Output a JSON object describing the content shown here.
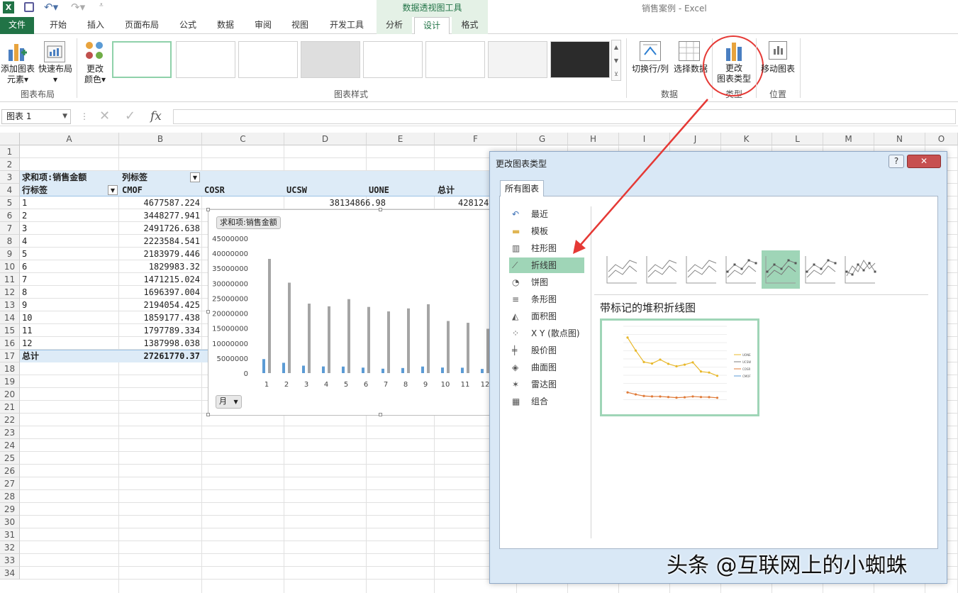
{
  "window": {
    "title": "销售案例 - Excel",
    "context_tab_group": "数据透视图工具"
  },
  "ribbon_tabs": [
    "文件",
    "开始",
    "插入",
    "页面布局",
    "公式",
    "数据",
    "审阅",
    "视图",
    "开发工具",
    "分析",
    "设计",
    "格式"
  ],
  "ribbon": {
    "add_element": [
      "添加图表",
      "元素"
    ],
    "quick_layout": "快速布局",
    "change_color": [
      "更改",
      "颜色"
    ],
    "switch_rowcol": "切换行/列",
    "select_data": "选择数据",
    "change_type": [
      "更改",
      "图表类型"
    ],
    "move_chart": "移动图表",
    "groups": {
      "layout": "图表布局",
      "styles": "图表样式",
      "data": "数据",
      "type": "类型",
      "location": "位置"
    }
  },
  "formula_bar": {
    "name_box": "图表 1",
    "fx": "fx",
    "value": ""
  },
  "columns": [
    "A",
    "B",
    "C",
    "D",
    "E",
    "F",
    "G",
    "H",
    "I",
    "J",
    "K",
    "L",
    "M",
    "N",
    "O"
  ],
  "rows": [
    "1",
    "2",
    "3",
    "4",
    "5",
    "6",
    "7",
    "8",
    "9",
    "10",
    "11",
    "12",
    "13",
    "14",
    "15",
    "16",
    "17",
    "18",
    "19",
    "20",
    "21",
    "22",
    "23",
    "24",
    "25",
    "26",
    "27",
    "28",
    "29",
    "30",
    "31",
    "32",
    "33",
    "34"
  ],
  "pivot": {
    "values_label": "求和项:销售金额",
    "col_labels": "列标签",
    "row_labels": "行标签",
    "col_headers": [
      "CMOF",
      "COSR",
      "UCSW",
      "UONE",
      "总计"
    ],
    "row_values": [
      "1",
      "2",
      "3",
      "4",
      "5",
      "6",
      "7",
      "8",
      "9",
      "10",
      "11",
      "12"
    ],
    "col_b": [
      "4677587.224",
      "3448277.941",
      "2491726.638",
      "2223584.541",
      "2183979.446",
      "1829983.32",
      "1471215.024",
      "1696397.004",
      "2194054.425",
      "1859177.438",
      "1797789.334",
      "1387998.038"
    ],
    "d5": "38134866.98",
    "f5_partial": "428124",
    "total_label": "总计",
    "total_b": "27261770.37"
  },
  "chart_data": {
    "type": "bar",
    "title": "",
    "series_button": "求和项:销售金额",
    "field_button": "月",
    "categories": [
      "1",
      "2",
      "3",
      "4",
      "5",
      "6",
      "7",
      "8",
      "9",
      "10",
      "11",
      "12"
    ],
    "yticks": [
      "0",
      "5000000",
      "10000000",
      "15000000",
      "20000000",
      "25000000",
      "30000000",
      "35000000",
      "40000000",
      "45000000"
    ],
    "ylim": [
      0,
      45000000
    ],
    "series": [
      {
        "color": "#5b9bd5",
        "values": [
          4677587,
          3448278,
          2491727,
          2223585,
          2183979,
          1829983,
          1471215,
          1696397,
          2194054,
          1859177,
          1797789,
          1387998
        ]
      },
      {
        "color": "#a5a5a5",
        "values": [
          38134867,
          30200000,
          23200000,
          22300000,
          24700000,
          22100000,
          20600000,
          21600000,
          23000000,
          17400000,
          16800000,
          14800000
        ]
      }
    ]
  },
  "dialog": {
    "title": "更改图表类型",
    "help": "?",
    "close": "✕",
    "tab": "所有图表",
    "chart_types": [
      {
        "label": "最近",
        "icon": "recent-icon"
      },
      {
        "label": "模板",
        "icon": "folder-icon"
      },
      {
        "label": "柱形图",
        "icon": "column-chart-icon"
      },
      {
        "label": "折线图",
        "icon": "line-chart-icon"
      },
      {
        "label": "饼图",
        "icon": "pie-chart-icon"
      },
      {
        "label": "条形图",
        "icon": "bar-chart-icon"
      },
      {
        "label": "面积图",
        "icon": "area-chart-icon"
      },
      {
        "label": "X Y (散点图)",
        "icon": "scatter-chart-icon"
      },
      {
        "label": "股价图",
        "icon": "stock-chart-icon"
      },
      {
        "label": "曲面图",
        "icon": "surface-chart-icon"
      },
      {
        "label": "雷达图",
        "icon": "radar-chart-icon"
      },
      {
        "label": "组合",
        "icon": "combo-chart-icon"
      }
    ],
    "selected_index": 3,
    "subtype_selected": 4,
    "subtype_title": "带标记的堆积折线图",
    "preview_legend": [
      "UONE",
      "UCSW",
      "COSR",
      "CMOF"
    ]
  },
  "watermark": "头条 @互联网上的小蜘蛛"
}
